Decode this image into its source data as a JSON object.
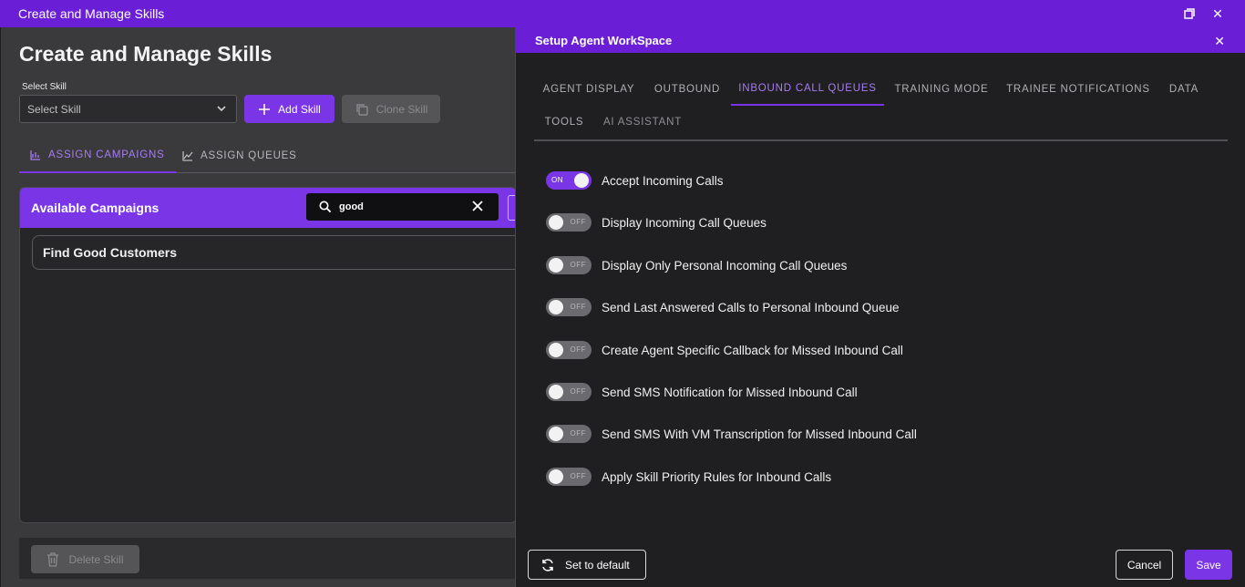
{
  "window": {
    "title": "Create and Manage Skills"
  },
  "main": {
    "page_title": "Create and Manage Skills",
    "select_label": "Select Skill",
    "select_value": "Select Skill",
    "add_skill": "Add Skill",
    "clone_skill": "Clone Skill",
    "tabs": [
      "ASSIGN CAMPAIGNS",
      "ASSIGN QUEUES"
    ],
    "active_tab": "ASSIGN CAMPAIGNS",
    "campaigns_header": "Available Campaigns",
    "search_value": "good",
    "campaigns": [
      "Find Good Customers"
    ],
    "delete_skill": "Delete Skill"
  },
  "panel": {
    "title": "Setup Agent WorkSpace",
    "tabs": [
      "AGENT DISPLAY",
      "OUTBOUND",
      "INBOUND CALL QUEUES",
      "TRAINING MODE",
      "TRAINEE NOTIFICATIONS",
      "DATA",
      "TOOLS",
      "AI ASSISTANT"
    ],
    "active_tab": "INBOUND CALL QUEUES",
    "on_text": "ON",
    "off_text": "OFF",
    "toggles": [
      {
        "label": "Accept Incoming Calls",
        "on": true
      },
      {
        "label": "Display Incoming Call Queues",
        "on": false
      },
      {
        "label": "Display Only Personal Incoming Call Queues",
        "on": false
      },
      {
        "label": "Send Last Answered Calls to Personal Inbound Queue",
        "on": false
      },
      {
        "label": "Create Agent Specific Callback for Missed Inbound Call",
        "on": false
      },
      {
        "label": "Send SMS Notification for Missed Inbound Call",
        "on": false
      },
      {
        "label": "Send SMS With VM Transcription for Missed Inbound Call",
        "on": false
      },
      {
        "label": "Apply Skill Priority Rules for Inbound Calls",
        "on": false
      }
    ],
    "set_default": "Set to default",
    "cancel": "Cancel",
    "save": "Save"
  },
  "colors": {
    "accent": "#7a36e6",
    "titlebar": "#6a1fd6",
    "active_tab": "#a77cf2"
  }
}
